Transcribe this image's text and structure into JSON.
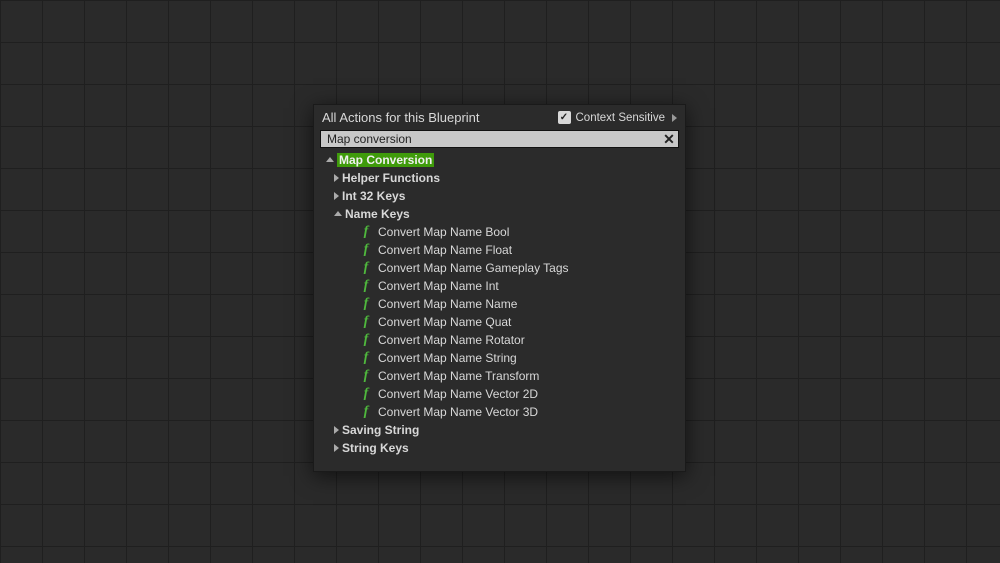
{
  "header": {
    "title": "All Actions for this Blueprint",
    "context_label": "Context Sensitive",
    "context_checked": true
  },
  "search": {
    "value": "Map conversion",
    "clear_glyph": "✕"
  },
  "tree": {
    "root": {
      "label": "Map Conversion",
      "expanded": true
    },
    "categories": [
      {
        "label": "Helper Functions",
        "expanded": false
      },
      {
        "label": "Int 32 Keys",
        "expanded": false
      },
      {
        "label": "Name Keys",
        "expanded": true,
        "children": [
          "Convert Map Name Bool",
          "Convert Map Name Float",
          "Convert Map Name Gameplay Tags",
          "Convert Map Name Int",
          "Convert Map Name Name",
          "Convert Map Name Quat",
          "Convert Map Name Rotator",
          "Convert Map Name String",
          "Convert Map Name Transform",
          "Convert Map Name Vector 2D",
          "Convert Map Name Vector 3D"
        ]
      },
      {
        "label": "Saving String",
        "expanded": false
      },
      {
        "label": "String Keys",
        "expanded": false
      }
    ]
  },
  "icons": {
    "func": "f",
    "check": "✓"
  }
}
